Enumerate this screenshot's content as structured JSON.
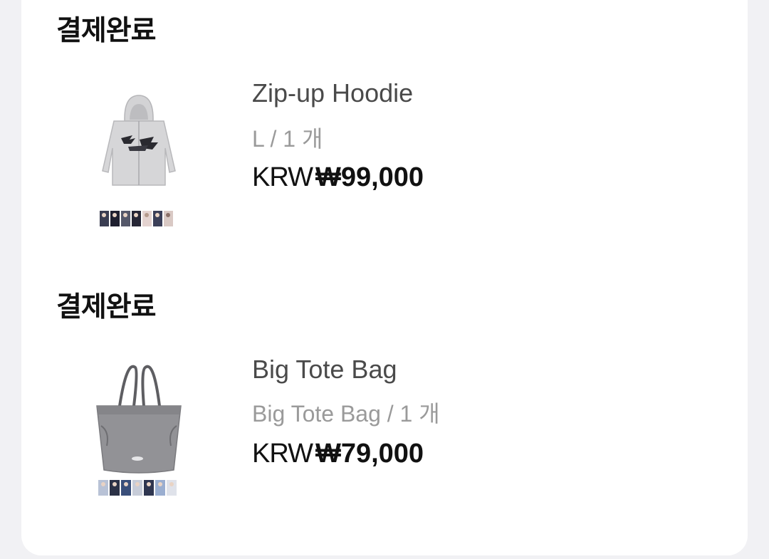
{
  "orders": [
    {
      "status": "결제완료",
      "product_name": "Zip-up Hoodie",
      "option": "L / 1 개",
      "currency": "KRW",
      "price": "₩99,000",
      "thumbnail": "hoodie-image"
    },
    {
      "status": "결제완료",
      "product_name": "Big Tote Bag",
      "option": "Big Tote Bag / 1 개",
      "currency": "KRW",
      "price": "₩79,000",
      "thumbnail": "tote-bag-image"
    }
  ],
  "colors": {
    "background": "#f1f1f4",
    "card": "#ffffff",
    "title": "#111111",
    "product_name": "#4a4a4a",
    "option": "#9a9a9a"
  }
}
